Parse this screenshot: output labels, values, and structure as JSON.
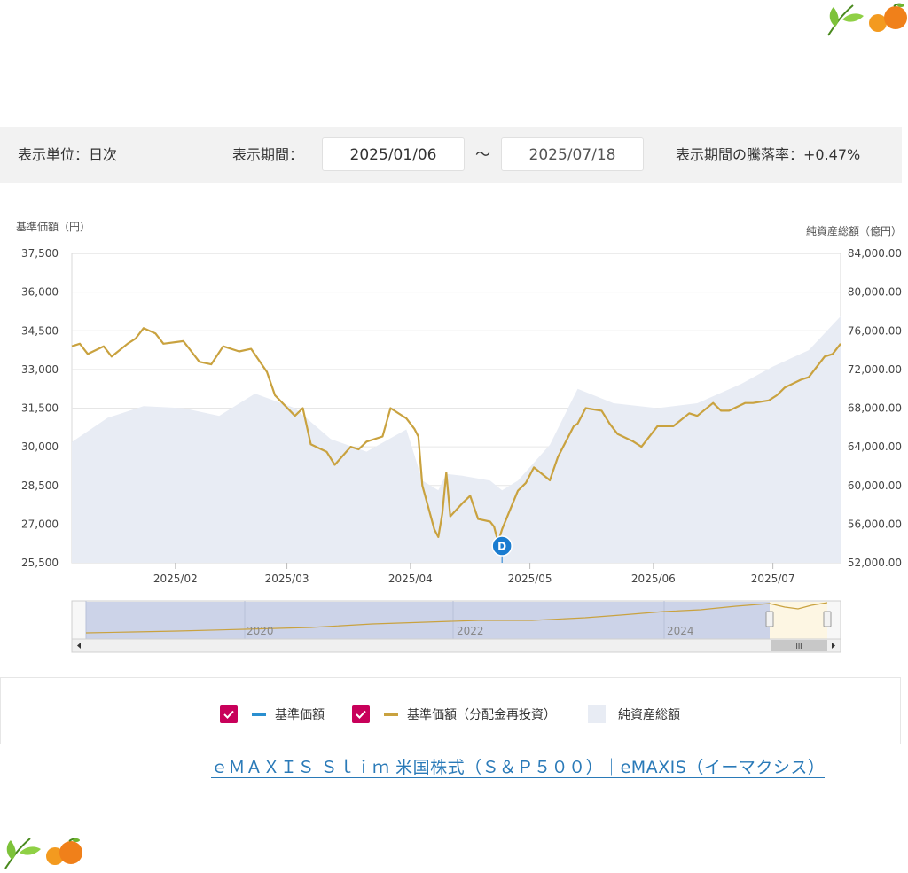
{
  "controls": {
    "unit_label": "表示単位：日次",
    "period_label": "表示期間：",
    "start_date": "2025/01/06",
    "tilde": "〜",
    "end_date": "2025/07/18",
    "change_label": "表示期間の騰落率：+0.47%"
  },
  "chart_data": {
    "type": "line",
    "y_left_label": "基準価額（円）",
    "y_right_label": "純資産総額（億円）",
    "y_left_ticks": [
      "37,500",
      "36,000",
      "34,500",
      "33,000",
      "31,500",
      "30,000",
      "28,500",
      "27,000",
      "25,500"
    ],
    "y_right_ticks": [
      "84,000.00",
      "80,000.00",
      "76,000.00",
      "72,000.00",
      "68,000.00",
      "64,000.00",
      "60,000.00",
      "56,000.00",
      "52,000.00"
    ],
    "x_ticks": [
      "2025/02",
      "2025/03",
      "2025/04",
      "2025/05",
      "2025/06",
      "2025/07"
    ],
    "ylim_left": [
      25500,
      37500
    ],
    "ylim_right": [
      52000,
      84000
    ],
    "marker_label": "D",
    "marker_date": "2025/04/24",
    "series": [
      {
        "name": "基準価額（分配金再投資）",
        "color": "#c9a23f",
        "x": [
          "2025/01/06",
          "2025/01/08",
          "2025/01/10",
          "2025/01/14",
          "2025/01/16",
          "2025/01/20",
          "2025/01/22",
          "2025/01/24",
          "2025/01/27",
          "2025/01/29",
          "2025/02/03",
          "2025/02/05",
          "2025/02/07",
          "2025/02/10",
          "2025/02/13",
          "2025/02/17",
          "2025/02/20",
          "2025/02/24",
          "2025/02/26",
          "2025/03/03",
          "2025/03/05",
          "2025/03/07",
          "2025/03/11",
          "2025/03/13",
          "2025/03/17",
          "2025/03/19",
          "2025/03/21",
          "2025/03/25",
          "2025/03/27",
          "2025/03/31",
          "2025/04/02",
          "2025/04/03",
          "2025/04/04",
          "2025/04/07",
          "2025/04/08",
          "2025/04/09",
          "2025/04/10",
          "2025/04/11",
          "2025/04/14",
          "2025/04/16",
          "2025/04/18",
          "2025/04/21",
          "2025/04/22",
          "2025/04/23",
          "2025/04/24",
          "2025/04/28",
          "2025/04/30",
          "2025/05/02",
          "2025/05/06",
          "2025/05/08",
          "2025/05/12",
          "2025/05/13",
          "2025/05/15",
          "2025/05/19",
          "2025/05/21",
          "2025/05/23",
          "2025/05/27",
          "2025/05/29",
          "2025/06/02",
          "2025/06/04",
          "2025/06/06",
          "2025/06/10",
          "2025/06/12",
          "2025/06/16",
          "2025/06/18",
          "2025/06/20",
          "2025/06/24",
          "2025/06/26",
          "2025/06/30",
          "2025/07/02",
          "2025/07/04",
          "2025/07/08",
          "2025/07/10",
          "2025/07/14",
          "2025/07/16",
          "2025/07/18"
        ],
        "values": [
          33900,
          34000,
          33600,
          33900,
          33500,
          34000,
          34200,
          34600,
          34400,
          34000,
          34100,
          33700,
          33300,
          33200,
          33900,
          33700,
          33800,
          32900,
          32000,
          31200,
          31500,
          30100,
          29800,
          29300,
          30000,
          29900,
          30200,
          30400,
          31500,
          31100,
          30700,
          30400,
          28500,
          26800,
          26500,
          27400,
          29000,
          27300,
          27800,
          28100,
          27200,
          27100,
          26900,
          26300,
          26800,
          28300,
          28600,
          29200,
          28700,
          29600,
          30800,
          30900,
          31500,
          31400,
          30900,
          30500,
          30200,
          30000,
          30800,
          30800,
          30800,
          31300,
          31200,
          31700,
          31400,
          31400,
          31700,
          31700,
          31800,
          32000,
          32300,
          32600,
          32700,
          33500,
          33600,
          34000
        ]
      },
      {
        "name": "純資産総額",
        "color": "#e8ecf4",
        "x": [
          "2025/01/06",
          "2025/01/15",
          "2025/01/24",
          "2025/02/03",
          "2025/02/12",
          "2025/02/21",
          "2025/03/03",
          "2025/03/12",
          "2025/03/21",
          "2025/03/31",
          "2025/04/04",
          "2025/04/08",
          "2025/04/10",
          "2025/04/14",
          "2025/04/21",
          "2025/04/24",
          "2025/04/28",
          "2025/05/06",
          "2025/05/13",
          "2025/05/22",
          "2025/06/02",
          "2025/06/12",
          "2025/06/23",
          "2025/07/01",
          "2025/07/10",
          "2025/07/18"
        ],
        "values": [
          64500,
          67000,
          68200,
          68000,
          67200,
          69500,
          68000,
          64800,
          63500,
          65800,
          60500,
          59500,
          61200,
          61000,
          60500,
          59500,
          60500,
          64200,
          70000,
          68500,
          68000,
          68500,
          70500,
          72300,
          74000,
          77500
        ]
      }
    ]
  },
  "navigator": {
    "year_labels": [
      "2020",
      "2022",
      "2024"
    ],
    "handle_glyph": "III"
  },
  "legend": {
    "items": [
      {
        "label": "基準価額",
        "color": "#2a8fd0"
      },
      {
        "label": "基準価額（分配金再投資）",
        "color": "#c9a23f"
      },
      {
        "label": "純資産総額",
        "color": "#e8ecf4"
      }
    ]
  },
  "link": {
    "text": "ｅＭＡＸＩＳ Ｓｌｉｍ 米国株式（Ｓ＆Ｐ５００）｜eMAXIS（イーマクシス）"
  }
}
